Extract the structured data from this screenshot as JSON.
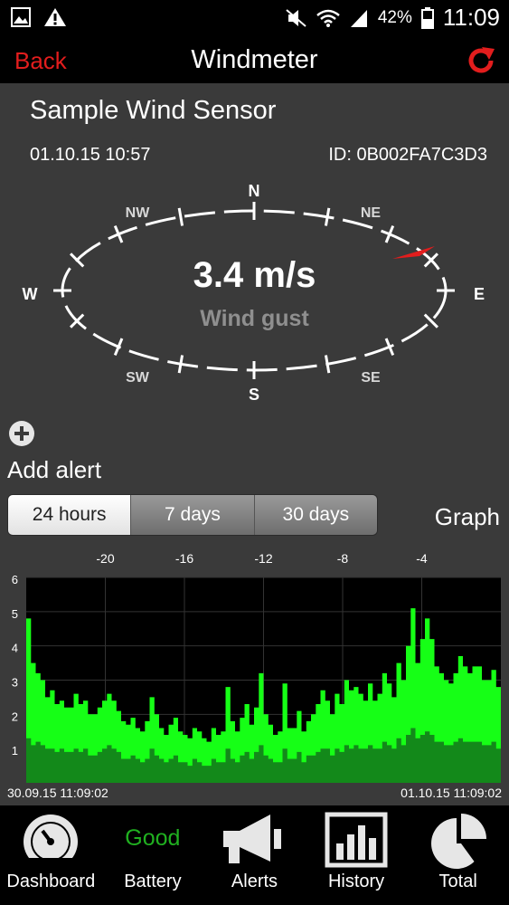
{
  "status_bar": {
    "battery_percent": "42%",
    "time": "11:09"
  },
  "header": {
    "back_label": "Back",
    "title": "Windmeter"
  },
  "sensor": {
    "name": "Sample Wind Sensor",
    "datetime": "01.10.15  10:57",
    "id": "ID: 0B002FA7C3D3"
  },
  "compass": {
    "labels": {
      "n": "N",
      "ne": "NE",
      "e": "E",
      "se": "SE",
      "s": "S",
      "sw": "SW",
      "w": "W",
      "nw": "NW"
    },
    "speed": "3.4 m/s",
    "speed_label": "Wind gust",
    "direction": "ENE",
    "accent": "#e21d1d"
  },
  "alerts": {
    "add_label": "Add alert"
  },
  "range": {
    "options": [
      "24 hours",
      "7 days",
      "30 days"
    ],
    "selected": "24 hours",
    "graph_label": "Graph"
  },
  "chart_data": {
    "type": "area",
    "x_ticks_top": [
      "-20",
      "-16",
      "-12",
      "-8",
      "-4"
    ],
    "y_ticks": [
      "1",
      "2",
      "3",
      "4",
      "5",
      "6"
    ],
    "ylim": [
      0,
      6
    ],
    "start_label": "30.09.15  11:09:02",
    "end_label": "01.10.15  11:09:02",
    "series": [
      {
        "color": "#16ff16",
        "values": [
          4.8,
          3.5,
          3.2,
          3.0,
          2.5,
          2.7,
          2.3,
          2.4,
          2.2,
          2.2,
          2.6,
          2.3,
          2.4,
          2.0,
          2.0,
          2.2,
          2.4,
          2.6,
          2.4,
          2.1,
          1.8,
          1.7,
          1.9,
          1.6,
          1.5,
          1.8,
          2.5,
          2.0,
          1.6,
          1.4,
          1.7,
          1.9,
          1.5,
          1.4,
          1.3,
          1.6,
          1.5,
          1.3,
          1.2,
          1.6,
          1.4,
          1.5,
          2.8,
          1.8,
          1.5,
          1.9,
          2.3,
          1.7,
          2.2,
          3.2,
          2.0,
          1.7,
          1.4,
          1.5,
          2.9,
          1.6,
          1.6,
          2.1,
          1.5,
          1.8,
          2.0,
          2.3,
          2.7,
          2.4,
          2.0,
          2.6,
          2.3,
          3.0,
          2.7,
          2.8,
          2.6,
          2.4,
          2.9,
          2.4,
          2.6,
          3.2,
          2.9,
          2.5,
          3.5,
          3.0,
          4.0,
          5.1,
          3.5,
          4.2,
          4.8,
          4.2,
          3.4,
          3.2,
          3.0,
          2.9,
          3.2,
          3.7,
          3.4,
          3.2,
          3.4,
          3.4,
          3.0,
          3.0,
          3.3,
          2.8
        ]
      },
      {
        "color": "#13891a",
        "values": [
          1.3,
          1.1,
          1.2,
          1.1,
          1.0,
          1.0,
          0.9,
          1.0,
          0.9,
          0.9,
          1.0,
          0.9,
          1.0,
          0.8,
          0.8,
          0.9,
          1.0,
          1.1,
          1.0,
          0.9,
          0.7,
          0.7,
          0.8,
          0.7,
          0.6,
          0.7,
          1.0,
          0.8,
          0.7,
          0.6,
          0.7,
          0.8,
          0.6,
          0.6,
          0.5,
          0.7,
          0.6,
          0.5,
          0.5,
          0.7,
          0.6,
          0.6,
          1.0,
          0.7,
          0.6,
          0.8,
          0.9,
          0.7,
          0.9,
          1.1,
          0.8,
          0.7,
          0.6,
          0.6,
          1.0,
          0.7,
          0.7,
          0.9,
          0.6,
          0.8,
          0.8,
          0.9,
          1.0,
          1.0,
          0.8,
          1.0,
          0.9,
          1.1,
          1.0,
          1.1,
          1.0,
          1.0,
          1.1,
          1.0,
          1.0,
          1.2,
          1.1,
          1.0,
          1.3,
          1.1,
          1.4,
          1.6,
          1.3,
          1.4,
          1.5,
          1.4,
          1.2,
          1.2,
          1.1,
          1.1,
          1.2,
          1.3,
          1.2,
          1.2,
          1.2,
          1.2,
          1.1,
          1.1,
          1.2,
          1.0
        ]
      }
    ]
  },
  "tabs": [
    {
      "label": "Dashboard",
      "icon": "gauge-icon"
    },
    {
      "label": "Battery",
      "icon": "battery-status",
      "value": "Good",
      "value_color": "#20b020"
    },
    {
      "label": "Alerts",
      "icon": "megaphone-icon"
    },
    {
      "label": "History",
      "icon": "bar-chart-icon"
    },
    {
      "label": "Total",
      "icon": "pie-chart-icon"
    }
  ]
}
